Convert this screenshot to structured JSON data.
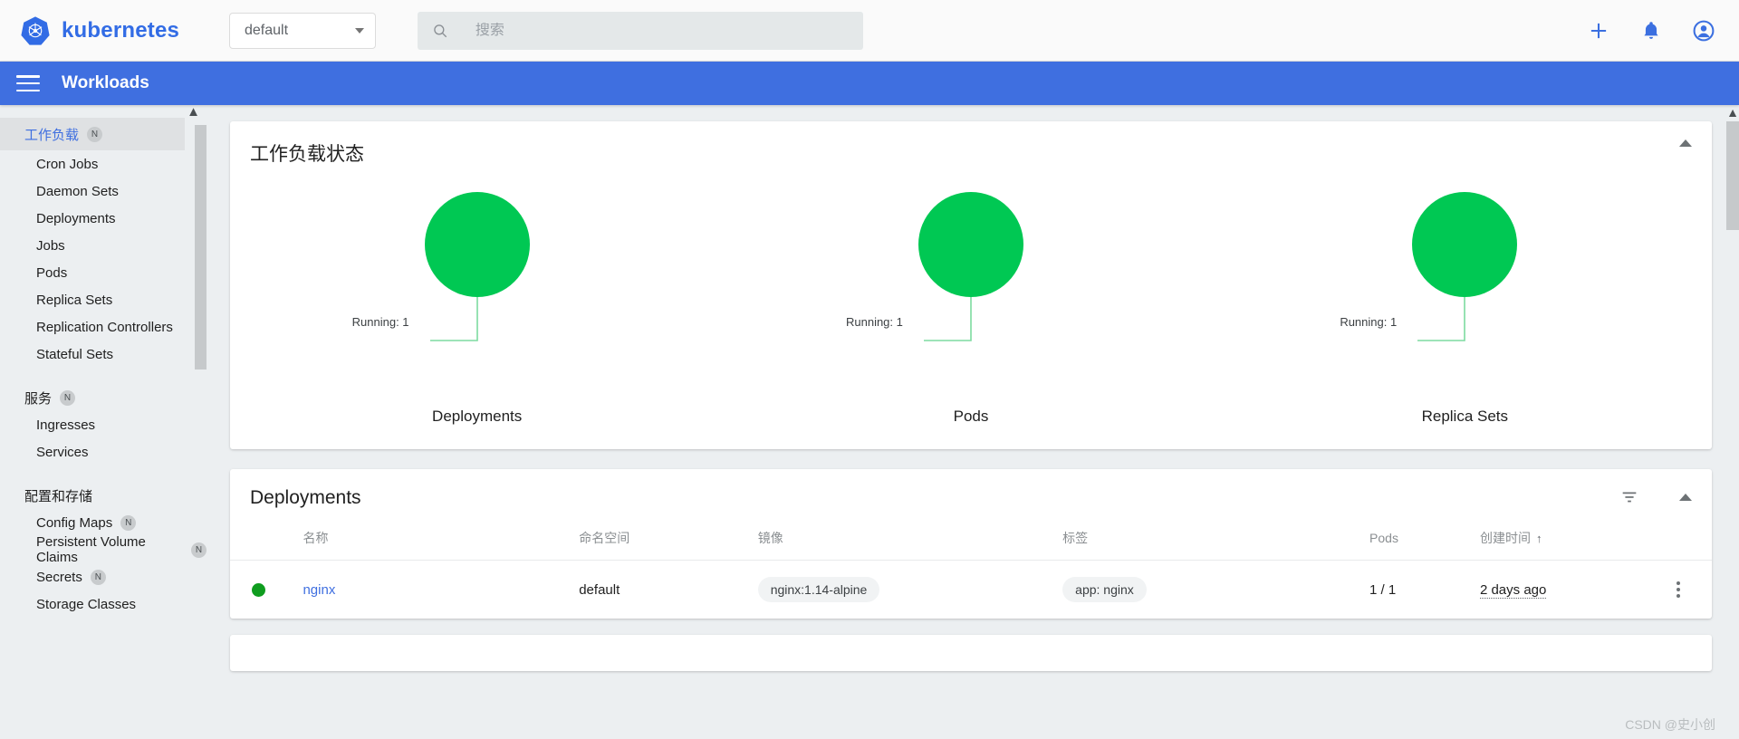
{
  "topbar": {
    "brand": "kubernetes",
    "brand_color": "#326ce5",
    "namespace_selected": "default",
    "search_placeholder": "搜索",
    "search_value": "",
    "icons": [
      "plus-icon",
      "bell-icon",
      "account-circle-icon"
    ]
  },
  "actionbar": {
    "title": "Workloads",
    "background": "#3f6fe0"
  },
  "sidebar": {
    "groups": [
      {
        "label": "工作负载",
        "badge": "N",
        "selected": true,
        "items": [
          {
            "label": "Cron Jobs",
            "badge": ""
          },
          {
            "label": "Daemon Sets",
            "badge": ""
          },
          {
            "label": "Deployments",
            "badge": ""
          },
          {
            "label": "Jobs",
            "badge": ""
          },
          {
            "label": "Pods",
            "badge": ""
          },
          {
            "label": "Replica Sets",
            "badge": ""
          },
          {
            "label": "Replication Controllers",
            "badge": ""
          },
          {
            "label": "Stateful Sets",
            "badge": ""
          }
        ]
      },
      {
        "label": "服务",
        "badge": "N",
        "selected": false,
        "items": [
          {
            "label": "Ingresses",
            "badge": ""
          },
          {
            "label": "Services",
            "badge": ""
          }
        ]
      },
      {
        "label": "配置和存储",
        "badge": "",
        "selected": false,
        "items": [
          {
            "label": "Config Maps",
            "badge": "N"
          },
          {
            "label": "Persistent Volume Claims",
            "badge": "N"
          },
          {
            "label": "Secrets",
            "badge": "N"
          },
          {
            "label": "Storage Classes",
            "badge": ""
          }
        ]
      }
    ]
  },
  "status_card": {
    "title": "工作负载状态"
  },
  "chart_data": [
    {
      "type": "pie",
      "title": "Deployments",
      "categories": [
        "Running"
      ],
      "values": [
        1
      ],
      "labels": [
        "Running: 1"
      ],
      "colors": [
        "#00c853"
      ],
      "total": 1
    },
    {
      "type": "pie",
      "title": "Pods",
      "categories": [
        "Running"
      ],
      "values": [
        1
      ],
      "labels": [
        "Running: 1"
      ],
      "colors": [
        "#00c853"
      ],
      "total": 1
    },
    {
      "type": "pie",
      "title": "Replica Sets",
      "categories": [
        "Running"
      ],
      "values": [
        1
      ],
      "labels": [
        "Running: 1"
      ],
      "colors": [
        "#00c853"
      ],
      "total": 1
    }
  ],
  "deployments_card": {
    "title": "Deployments",
    "columns": [
      "名称",
      "命名空间",
      "镜像",
      "标签",
      "Pods",
      "创建时间"
    ],
    "sort_column": "创建时间",
    "sort_arrow": "↑",
    "rows": [
      {
        "status": "running",
        "name": "nginx",
        "namespace": "default",
        "image": "nginx:1.14-alpine",
        "label": "app: nginx",
        "pods": "1 / 1",
        "age": "2 days ago"
      }
    ]
  },
  "watermark": "CSDN @史小创"
}
